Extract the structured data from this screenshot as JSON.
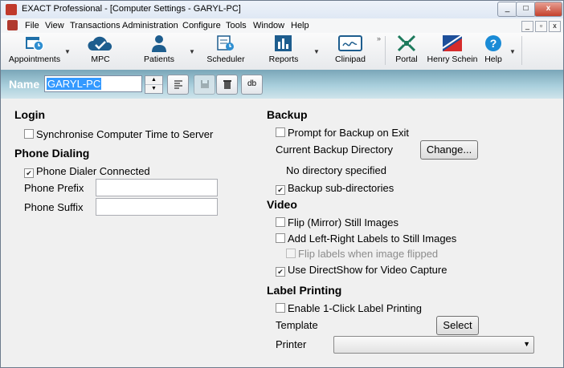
{
  "window": {
    "title": "EXACT Professional - [Computer Settings - GARYL-PC]"
  },
  "window_controls": {
    "minimize": "_",
    "maximize": "□",
    "close": "x"
  },
  "menubar": {
    "items": [
      "File",
      "View",
      "Transactions",
      "Administration",
      "Configure",
      "Tools",
      "Window",
      "Help"
    ],
    "mdi": [
      "_",
      "▫",
      "x"
    ]
  },
  "toolbar": {
    "buttons": [
      {
        "label": "Appointments",
        "icon": "calendar-clock-icon"
      },
      {
        "label": "MPC",
        "icon": "cloud-check-icon"
      },
      {
        "label": "Patients",
        "icon": "person-icon"
      },
      {
        "label": "Scheduler",
        "icon": "scheduler-icon"
      },
      {
        "label": "Reports",
        "icon": "bar-chart-icon"
      },
      {
        "label": "Clinipad",
        "icon": "clinipad-icon"
      },
      {
        "label": "Portal",
        "icon": "portal-arrows-icon"
      },
      {
        "label": "Henry Schein",
        "icon": "henry-schein-logo"
      },
      {
        "label": "Help",
        "icon": "help-icon"
      }
    ],
    "chevron": "»",
    "dropdown_arrow": "▼"
  },
  "name_bar": {
    "label": "Name",
    "value": "GARYL-PC",
    "db_label": "db"
  },
  "login": {
    "heading": "Login",
    "sync_time": {
      "label": "Synchronise Computer Time to Server",
      "checked": false
    }
  },
  "phone": {
    "heading": "Phone Dialing",
    "dialer_connected": {
      "label": "Phone Dialer Connected",
      "checked": true
    },
    "prefix_label": "Phone Prefix",
    "prefix_value": "",
    "suffix_label": "Phone Suffix",
    "suffix_value": ""
  },
  "backup": {
    "heading": "Backup",
    "prompt_on_exit": {
      "label": "Prompt for Backup on Exit",
      "checked": false
    },
    "current_dir_label": "Current Backup Directory",
    "change_button": "Change...",
    "no_dir_text": "No directory specified",
    "sub_dirs": {
      "label": "Backup sub-directories",
      "checked": true
    }
  },
  "video": {
    "heading": "Video",
    "flip": {
      "label": "Flip (Mirror) Still Images",
      "checked": false
    },
    "lr_labels": {
      "label": "Add Left-Right Labels to Still Images",
      "checked": false
    },
    "flip_labels": {
      "label": "Flip labels when image flipped",
      "checked": false
    },
    "directshow": {
      "label": "Use DirectShow for Video Capture",
      "checked": true
    }
  },
  "label_printing": {
    "heading": "Label Printing",
    "one_click": {
      "label": "Enable 1-Click Label Printing",
      "checked": false
    },
    "template_label": "Template",
    "select_button": "Select",
    "printer_label": "Printer",
    "printer_value": ""
  }
}
